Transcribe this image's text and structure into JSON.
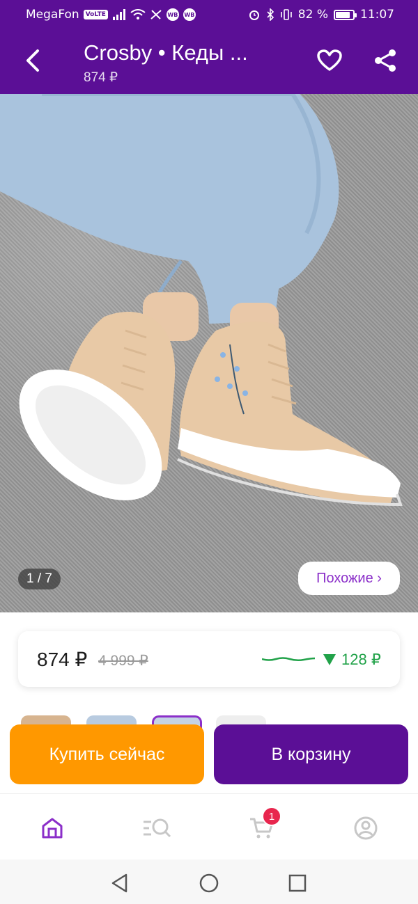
{
  "status_bar": {
    "carrier": "MegaFon",
    "volte": "VoLTE",
    "wb_badges": [
      "WB",
      "WB"
    ],
    "battery": "82 %",
    "battery_level": 0.82,
    "time": "11:07"
  },
  "header": {
    "title": "Crosby • Кеды ...",
    "price": "874 ₽",
    "back_icon": "chevron-left-icon",
    "favorite_icon": "heart-outline-icon",
    "share_icon": "share-icon"
  },
  "gallery": {
    "image_description": "sneakers",
    "counter_current": "1",
    "counter_total": "/ 7",
    "similar_label": "Похожие ›"
  },
  "price_card": {
    "price": "874 ₽",
    "old_price": "4 999 ₽",
    "discount": "128 ₽",
    "discount_color": "#21a249"
  },
  "actions": {
    "buy_now": "Купить сейчас",
    "add_to_cart": "В корзину"
  },
  "bottom_nav": {
    "items": [
      {
        "name": "home",
        "icon": "home-icon",
        "active": true
      },
      {
        "name": "catalog",
        "icon": "catalog-search-icon",
        "active": false
      },
      {
        "name": "cart",
        "icon": "cart-icon",
        "active": false,
        "badge": "1"
      },
      {
        "name": "profile",
        "icon": "profile-icon",
        "active": false
      }
    ]
  },
  "colors": {
    "brand": "#5b0f96",
    "buy_now": "#ff9800",
    "badge": "#e8264e"
  }
}
